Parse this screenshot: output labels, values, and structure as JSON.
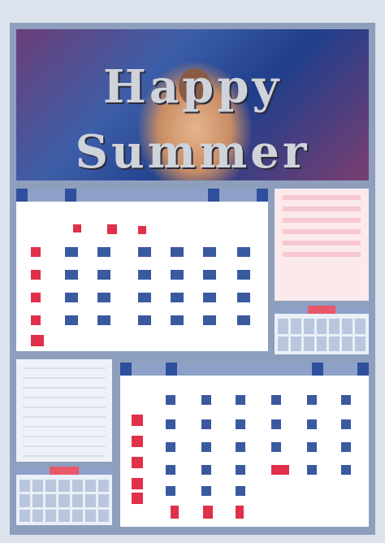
{
  "header": {
    "title_line1": "Happy",
    "title_line2": "Summer"
  },
  "colors": {
    "frame": "#8d9fbd",
    "accent_red": "#e8586a",
    "weekday_blue": "#3a5aa0",
    "holiday_red": "#e0304a"
  },
  "calendar_top": {
    "month_label": "",
    "days": [
      {
        "t": "",
        "c": "muted"
      },
      {
        "t": "",
        "c": "muted"
      },
      {
        "t": "",
        "c": "muted"
      },
      {
        "t": "",
        "c": "muted"
      },
      {
        "t": "",
        "c": "muted"
      },
      {
        "t": "",
        "c": "muted"
      },
      {
        "t": "",
        "c": "muted"
      }
    ]
  },
  "calendar_bottom": {
    "month_label": ""
  }
}
